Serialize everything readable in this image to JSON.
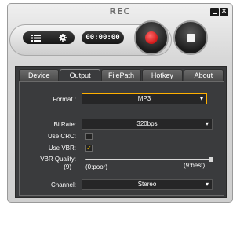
{
  "window": {
    "title": "REC",
    "minimize_label": "",
    "close_label": "✕"
  },
  "controls": {
    "menu_icon": "list-icon",
    "settings_icon": "gear-icon",
    "timer": "00:00:00",
    "record_icon": "record-icon",
    "stop_icon": "stop-icon"
  },
  "tabs": [
    {
      "label": "Device"
    },
    {
      "label": "Output"
    },
    {
      "label": "FilePath"
    },
    {
      "label": "Hotkey"
    },
    {
      "label": "About"
    }
  ],
  "active_tab": "Output",
  "output": {
    "format_label": "Format :",
    "format_value": "MP3",
    "bitrate_label": "BitRate:",
    "bitrate_value": "320bps",
    "use_crc_label": "Use CRC:",
    "use_crc_checked": false,
    "use_vbr_label": "Use VBR:",
    "use_vbr_checked": true,
    "vbr_quality_label_line1": "VBR Quality:",
    "vbr_quality_label_line2": "(9)",
    "vbr_quality_value": 9,
    "vbr_quality_min_label": "(0:poor)",
    "vbr_quality_max_label": "(9:best)",
    "channel_label": "Channel:",
    "channel_value": "Stereo"
  },
  "colors": {
    "record_red": "#d01818",
    "panel_bg": "#3a3b3d",
    "focus_border": "#ffb000",
    "check_mark": "#e0b000"
  }
}
